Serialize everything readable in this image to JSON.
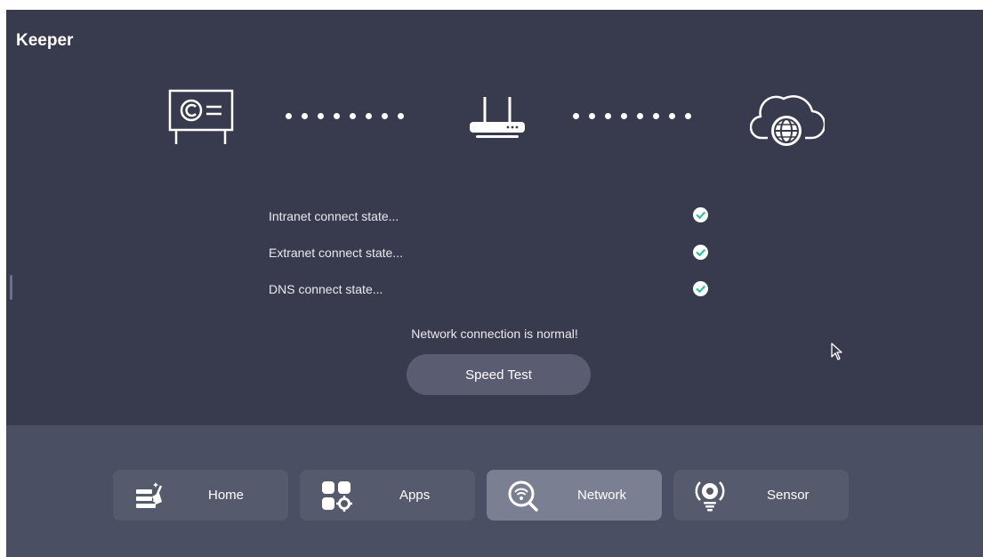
{
  "app": {
    "title": "Keeper"
  },
  "diagram": {
    "icons": [
      "display-board-icon",
      "router-icon",
      "cloud-globe-icon"
    ]
  },
  "states": [
    {
      "label": "Intranet connect state...",
      "icon": "check-circle-icon"
    },
    {
      "label": "Extranet connect state...",
      "icon": "check-circle-icon"
    },
    {
      "label": "DNS connect state...",
      "icon": "check-circle-icon"
    }
  ],
  "status_message": "Network connection is normal!",
  "speed_test_label": "Speed Test",
  "nav": {
    "items": [
      {
        "label": "Home",
        "icon": "home-clean-icon",
        "active": false
      },
      {
        "label": "Apps",
        "icon": "apps-grid-icon",
        "active": false
      },
      {
        "label": "Network",
        "icon": "network-search-icon",
        "active": true
      },
      {
        "label": "Sensor",
        "icon": "sensor-icon",
        "active": false
      }
    ]
  },
  "colors": {
    "background": "#383b4d",
    "bottom_bar": "#4b4f63",
    "button": "#565a6d",
    "button_active": "#7b7f92",
    "check": "#2fc29a"
  }
}
